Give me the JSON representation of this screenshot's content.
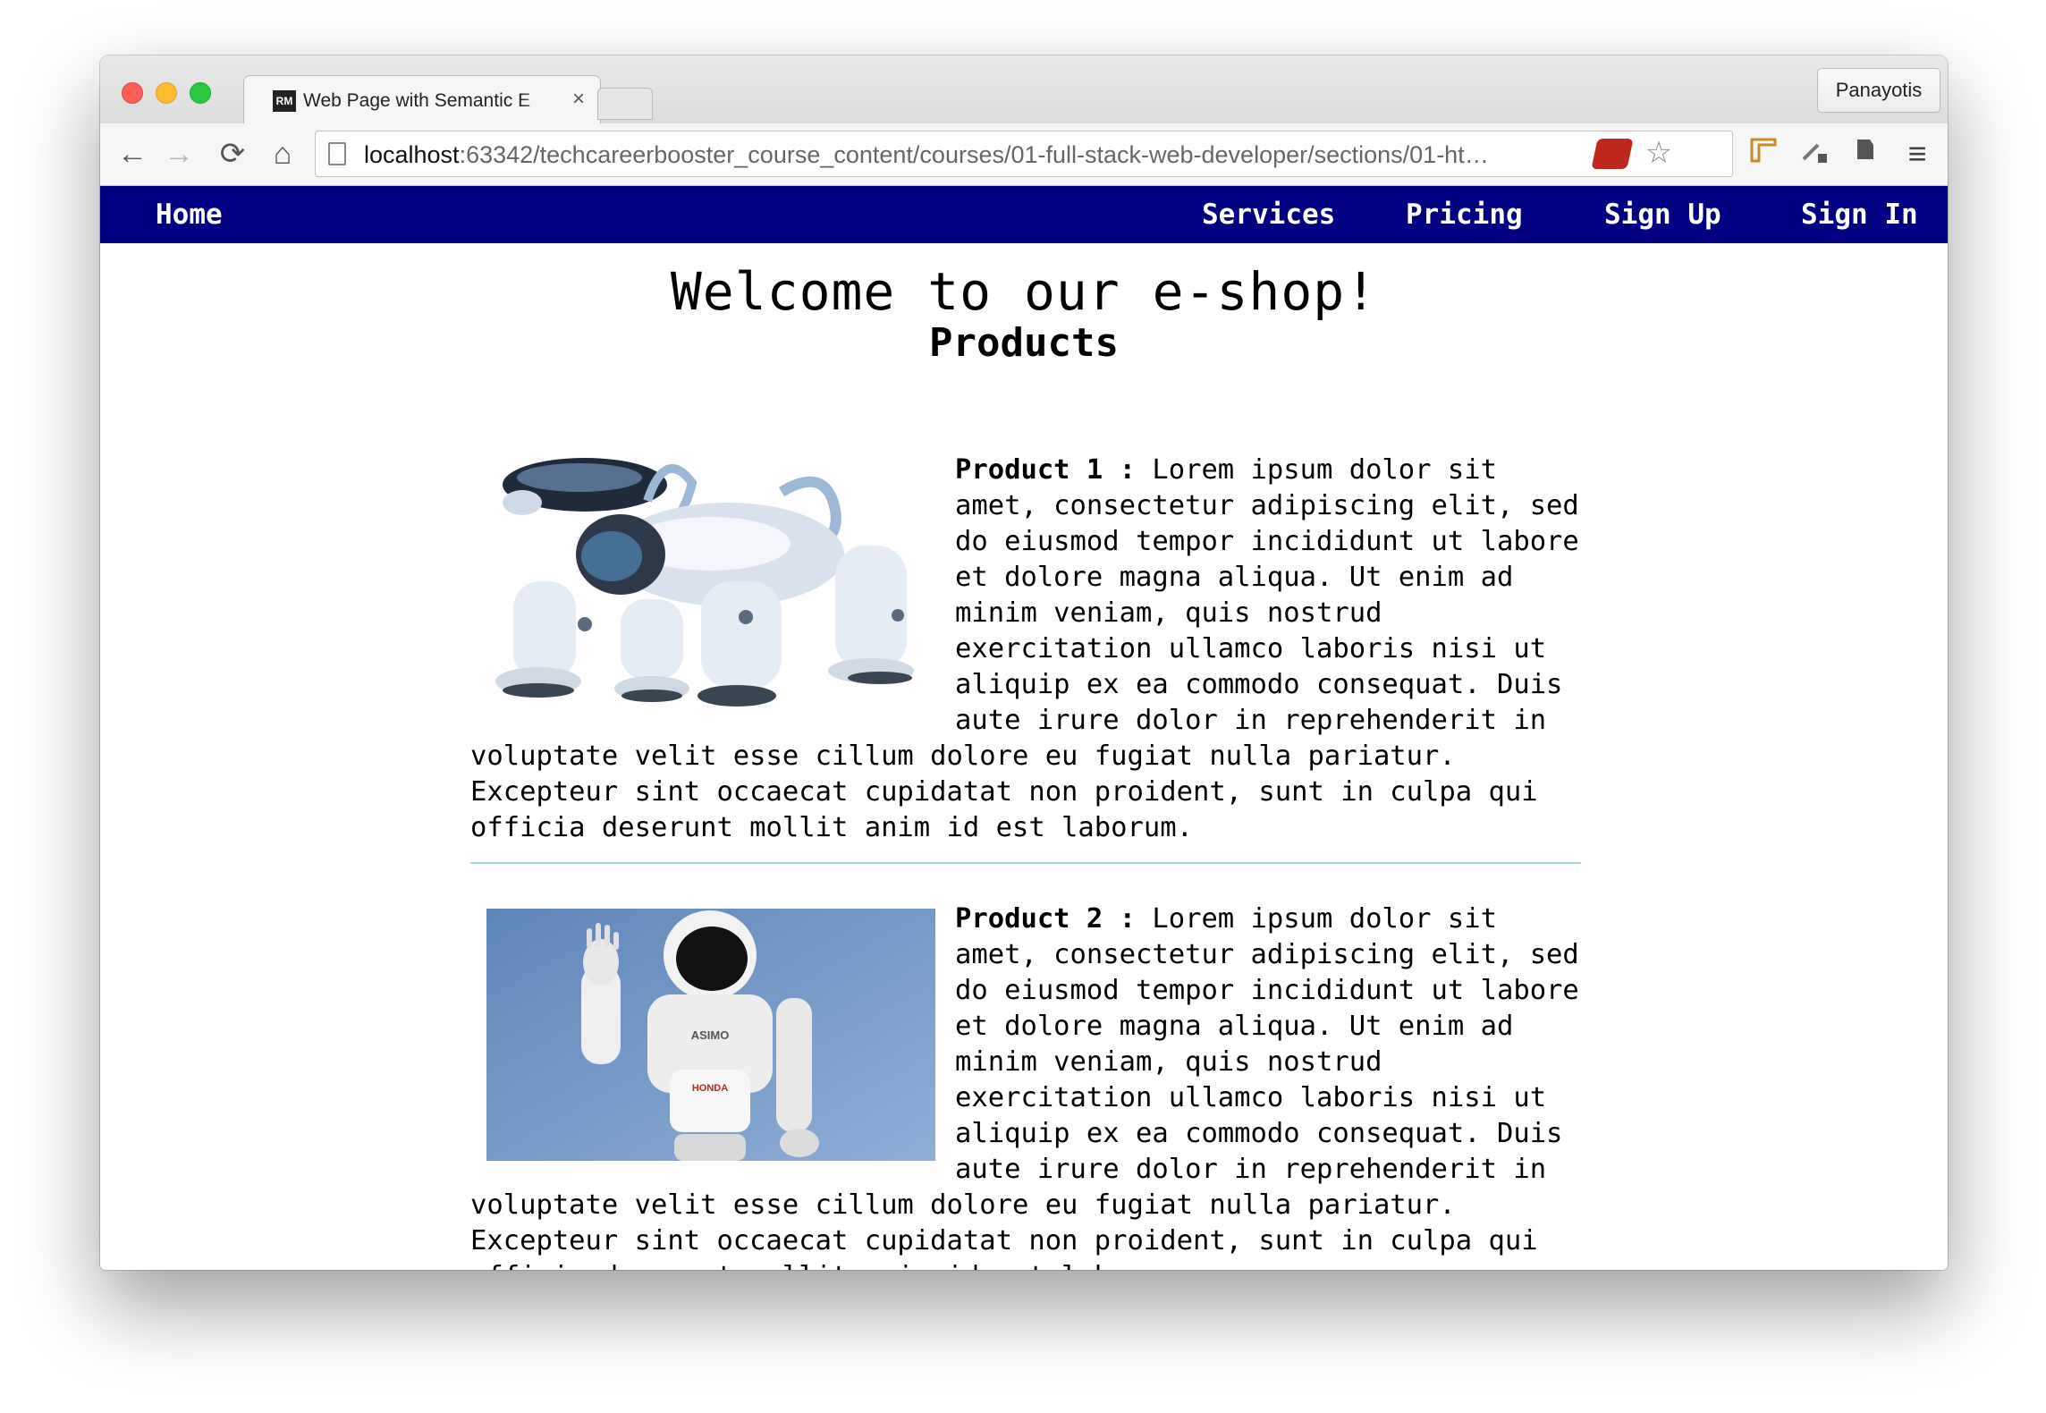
{
  "browser": {
    "tab_title": "Web Page with Semantic E",
    "tab_favicon": "RM",
    "tab_close": "×",
    "profile": "Panayotis",
    "url_host": "localhost",
    "url_rest": ":63342/techcareerbooster_course_content/courses/01-full-stack-web-developer/sections/01-ht…",
    "icons": {
      "back": "←",
      "forward": "→",
      "reload": "⟳",
      "home": "⌂",
      "star": "☆",
      "menu": "≡"
    }
  },
  "nav": {
    "home": "Home",
    "services": "Services",
    "pricing": "Pricing",
    "sign_up": "Sign Up",
    "sign_in": "Sign In"
  },
  "page": {
    "title": "Welcome to our e-shop!",
    "products_heading": "Products",
    "products": [
      {
        "name": "Product 1 :",
        "description": "Lorem ipsum dolor sit amet, consectetur adipiscing elit, sed do eiusmod tempor incididunt ut labore et dolore magna aliqua. Ut enim ad minim veniam, quis nostrud exercitation ullamco laboris nisi ut aliquip ex ea commodo consequat. Duis aute irure dolor in reprehenderit in voluptate velit esse cillum dolore eu fugiat nulla pariatur. Excepteur sint occaecat cupidatat non proident, sunt in culpa qui officia deserunt mollit anim id est laborum.",
        "image": "robot-dog-image"
      },
      {
        "name": "Product 2 :",
        "description": "Lorem ipsum dolor sit amet, consectetur adipiscing elit, sed do eiusmod tempor incididunt ut labore et dolore magna aliqua. Ut enim ad minim veniam, quis nostrud exercitation ullamco laboris nisi ut aliquip ex ea commodo consequat. Duis aute irure dolor in reprehenderit in voluptate velit esse cillum dolore eu fugiat nulla pariatur. Excepteur sint occaecat cupidatat non proident, sunt in culpa qui officia deserunt mollit anim id est laborum.",
        "image": "humanoid-robot-image",
        "image_text": {
          "chest": "ASIMO",
          "brand": "HONDA"
        }
      }
    ]
  },
  "colors": {
    "navbar": "#000080",
    "divider": "#a9d6dd"
  }
}
